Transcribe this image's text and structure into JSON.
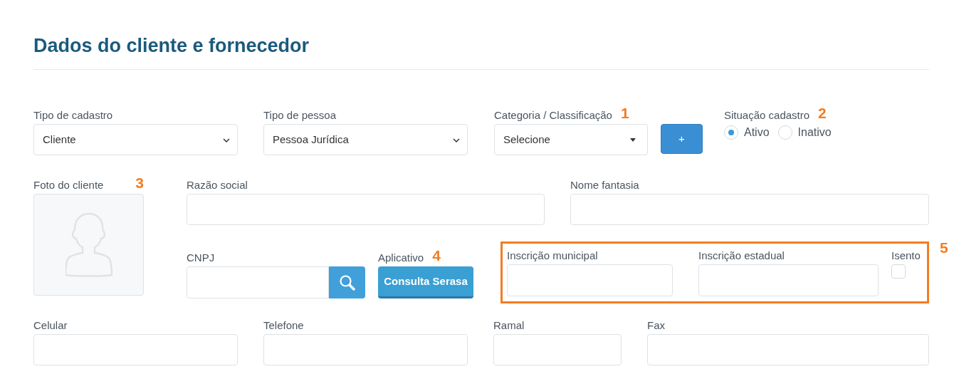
{
  "title": "Dados do cliente e fornecedor",
  "tipo_cadastro": {
    "label": "Tipo de cadastro",
    "value": "Cliente"
  },
  "tipo_pessoa": {
    "label": "Tipo de pessoa",
    "value": "Pessoa Jurídica"
  },
  "categoria": {
    "label": "Categoria / Classificação",
    "marker": "1",
    "value": "Selecione",
    "add_button": "+"
  },
  "situacao": {
    "label": "Situação cadastro",
    "marker": "2",
    "options": [
      {
        "label": "Ativo",
        "selected": true
      },
      {
        "label": "Inativo",
        "selected": false
      }
    ]
  },
  "foto": {
    "label": "Foto do cliente",
    "marker": "3"
  },
  "razao_social": {
    "label": "Razão social"
  },
  "nome_fantasia": {
    "label": "Nome fantasia"
  },
  "cnpj": {
    "label": "CNPJ"
  },
  "aplicativo": {
    "label": "Aplicativo",
    "marker": "4",
    "button": "Consulta Serasa"
  },
  "inscricoes": {
    "marker": "5",
    "municipal": {
      "label": "Inscrição municipal"
    },
    "estadual": {
      "label": "Inscrição estadual"
    },
    "isento": {
      "label": "Isento",
      "checked": false
    }
  },
  "contato": [
    {
      "label": "Celular"
    },
    {
      "label": "Telefone"
    },
    {
      "label": "Ramal"
    },
    {
      "label": "Fax"
    }
  ]
}
